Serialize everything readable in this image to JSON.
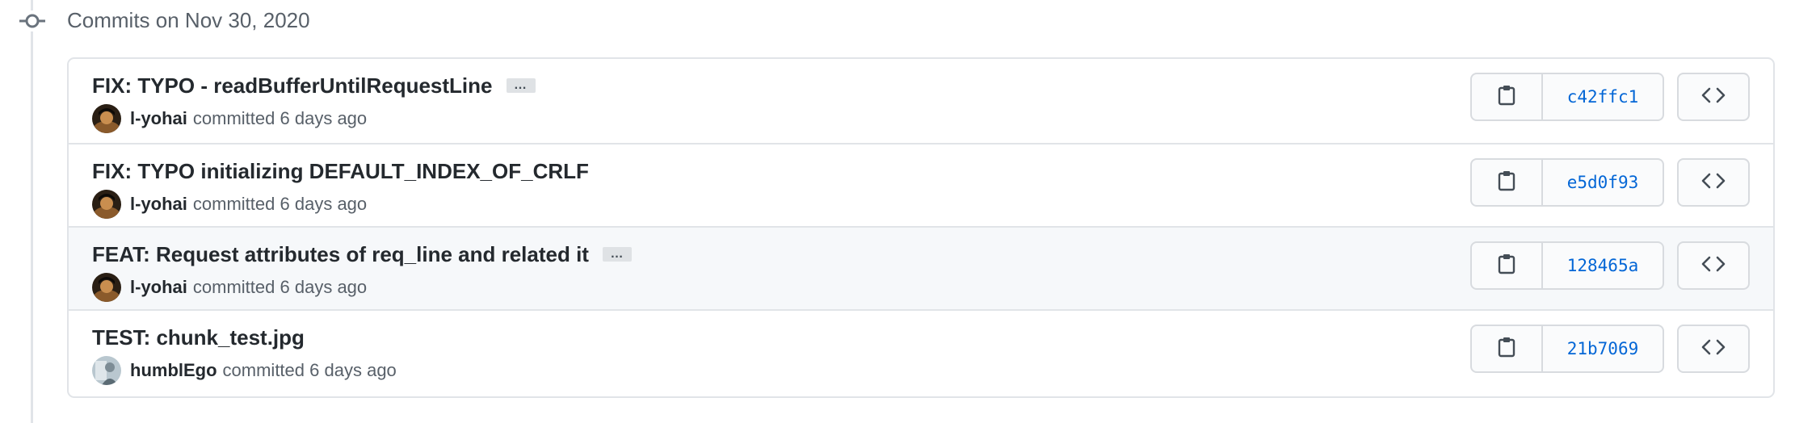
{
  "group": {
    "title": "Commits on Nov 30, 2020"
  },
  "commits": [
    {
      "title": "FIX: TYPO - readBufferUntilRequestLine",
      "has_more": true,
      "more_label": "…",
      "author": "l-yohai",
      "action": "committed",
      "time": "6 days ago",
      "sha": "c42ffc1",
      "avatar": "dark-photo"
    },
    {
      "title": "FIX: TYPO initializing DEFAULT_INDEX_OF_CRLF",
      "has_more": false,
      "author": "l-yohai",
      "action": "committed",
      "time": "6 days ago",
      "sha": "e5d0f93",
      "avatar": "dark-photo"
    },
    {
      "title": "FEAT: Request attributes of req_line and related it",
      "has_more": true,
      "more_label": "…",
      "author": "l-yohai",
      "action": "committed",
      "time": "6 days ago",
      "sha": "128465a",
      "avatar": "dark-photo"
    },
    {
      "title": "TEST: chunk_test.jpg",
      "has_more": false,
      "author": "humblEgo",
      "action": "committed",
      "time": "6 days ago",
      "sha": "21b7069",
      "avatar": "light-photo"
    }
  ],
  "icons": {
    "timeline": "git-commit-icon",
    "copy": "clipboard-icon",
    "browse": "code-icon"
  },
  "colors": {
    "link": "#0366d6",
    "muted": "#586069",
    "text": "#24292e",
    "border": "#e1e4e8",
    "row_highlight": "#f6f8fa"
  }
}
